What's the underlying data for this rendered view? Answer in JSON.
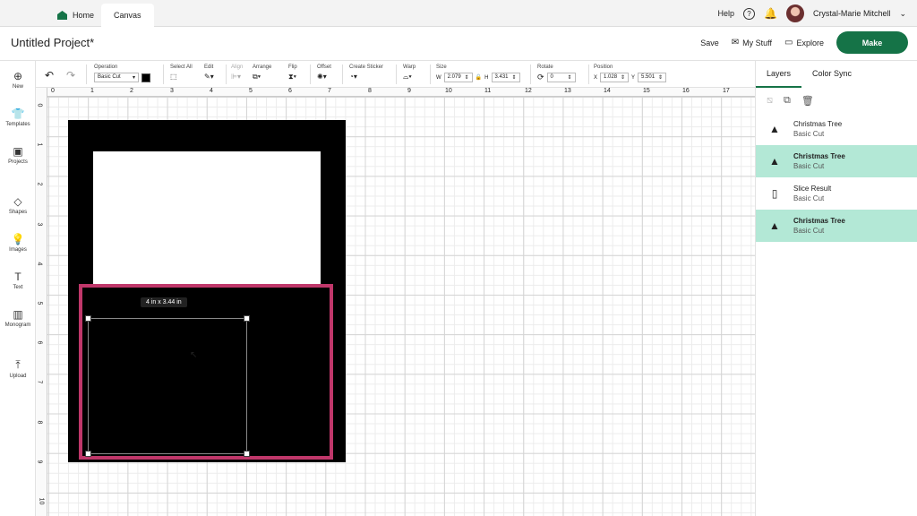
{
  "topbar": {
    "home_tab": "Home",
    "canvas_tab": "Canvas",
    "help": "Help",
    "help_icon": "?",
    "user_name": "Crystal-Marie Mitchell"
  },
  "header": {
    "project_title": "Untitled Project*",
    "save": "Save",
    "my_stuff": "My Stuff",
    "explore": "Explore",
    "make": "Make"
  },
  "leftbar": {
    "items": [
      {
        "label": "New",
        "icon": "⊕"
      },
      {
        "label": "Templates",
        "icon": "👕"
      },
      {
        "label": "Projects",
        "icon": "▣"
      },
      {
        "label": "Shapes",
        "icon": "◇"
      },
      {
        "label": "Images",
        "icon": "💡"
      },
      {
        "label": "Text",
        "icon": "T"
      },
      {
        "label": "Monogram",
        "icon": "▥"
      },
      {
        "label": "Upload",
        "icon": "⤒"
      }
    ]
  },
  "toolbar": {
    "operation_label": "Operation",
    "operation_value": "Basic Cut",
    "select_all": "Select All",
    "edit": "Edit",
    "align": "Align",
    "arrange": "Arrange",
    "flip": "Flip",
    "offset": "Offset",
    "create_sticker": "Create Sticker",
    "warp": "Warp",
    "size": "Size",
    "w_label": "W",
    "w_value": "2.079",
    "h_label": "H",
    "h_value": "3.431",
    "rotate": "Rotate",
    "rotate_value": "0",
    "position": "Position",
    "x_label": "X",
    "x_value": "1.028",
    "y_label": "Y",
    "y_value": "5.501"
  },
  "ruler": {
    "h_ticks": [
      "0",
      "1",
      "2",
      "3",
      "4",
      "5",
      "6",
      "7",
      "8",
      "9",
      "10",
      "11",
      "12",
      "13",
      "14",
      "15",
      "16",
      "17"
    ],
    "v_ticks": [
      "0",
      "1",
      "2",
      "3",
      "4",
      "5",
      "6",
      "7",
      "8",
      "9",
      "10"
    ]
  },
  "canvas": {
    "dimension_tooltip": "4  in x 3.44  in"
  },
  "rightpanel": {
    "tab_layers": "Layers",
    "tab_color_sync": "Color Sync",
    "layers": [
      {
        "name": "Christmas Tree",
        "sub": "Basic Cut",
        "selected": false
      },
      {
        "name": "Christmas Tree",
        "sub": "Basic Cut",
        "selected": true
      },
      {
        "name": "Slice Result",
        "sub": "Basic Cut",
        "selected": false
      },
      {
        "name": "Christmas Tree",
        "sub": "Basic Cut",
        "selected": true
      }
    ]
  },
  "colors": {
    "accent": "#157347",
    "selection": "#c0376a",
    "layer_selected": "#b3e8d6"
  }
}
